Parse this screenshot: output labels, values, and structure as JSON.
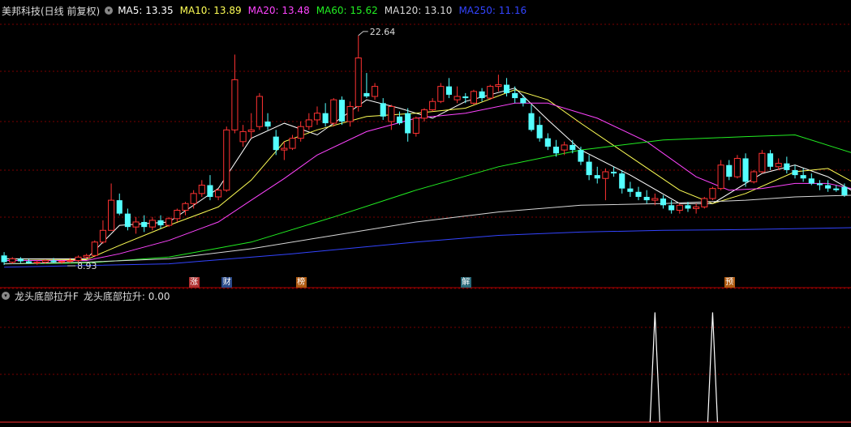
{
  "header": {
    "stock_title": "美邦科技(日线 前复权)",
    "ma": [
      {
        "label": "MA5: 13.35",
        "color": "#ffffff"
      },
      {
        "label": "MA10: 13.89",
        "color": "#ffff55"
      },
      {
        "label": "MA20: 13.48",
        "color": "#ff44ff"
      },
      {
        "label": "MA60: 15.62",
        "color": "#22ee22"
      },
      {
        "label": "MA120: 13.10",
        "color": "#d8d8d8"
      },
      {
        "label": "MA250: 11.16",
        "color": "#3344ff"
      }
    ]
  },
  "price_annotations": {
    "high_label": "22.64",
    "low_label": "8.93"
  },
  "events": [
    {
      "label": "涨",
      "bg": "#b03030"
    },
    {
      "label": "财",
      "bg": "#2a4a8a"
    },
    {
      "label": "榜",
      "bg": "#b05a10"
    },
    {
      "label": "解",
      "bg": "#2a6a7a"
    },
    {
      "label": "预",
      "bg": "#b05a10"
    }
  ],
  "indicator": {
    "name": "龙头底部拉升F",
    "value_label": "龙头底部拉升: 0.00"
  },
  "colors": {
    "up": "#ff3232",
    "down": "#54ffff",
    "grid": "#7a0000",
    "spike": "#ffffff"
  },
  "chart_data": {
    "type": "candlestick",
    "ohlc": [
      [
        9.5,
        9.7,
        8.93,
        9.1
      ],
      [
        9.1,
        9.4,
        9.0,
        9.3
      ],
      [
        9.3,
        9.4,
        9.05,
        9.15
      ],
      [
        9.15,
        9.3,
        9.0,
        9.05
      ],
      [
        9.05,
        9.2,
        8.95,
        9.1
      ],
      [
        9.1,
        9.25,
        9.0,
        9.2
      ],
      [
        9.2,
        9.35,
        9.05,
        9.1
      ],
      [
        9.1,
        9.2,
        9.0,
        9.15
      ],
      [
        9.15,
        9.35,
        9.05,
        9.2
      ],
      [
        9.2,
        9.5,
        9.1,
        9.4
      ],
      [
        9.4,
        9.6,
        9.3,
        9.5
      ],
      [
        9.5,
        10.4,
        9.4,
        10.3
      ],
      [
        10.3,
        11.6,
        10.2,
        11.0
      ],
      [
        11.0,
        13.8,
        11.0,
        12.8
      ],
      [
        12.8,
        13.2,
        11.9,
        12.0
      ],
      [
        12.0,
        12.3,
        11.0,
        11.2
      ],
      [
        11.2,
        11.8,
        10.8,
        11.5
      ],
      [
        11.5,
        11.9,
        10.9,
        11.2
      ],
      [
        11.2,
        11.8,
        11.0,
        11.6
      ],
      [
        11.6,
        11.9,
        11.1,
        11.3
      ],
      [
        11.3,
        11.8,
        11.2,
        11.7
      ],
      [
        11.7,
        12.3,
        11.5,
        12.2
      ],
      [
        12.2,
        12.7,
        11.9,
        12.6
      ],
      [
        12.6,
        13.4,
        12.3,
        13.2
      ],
      [
        13.2,
        14.0,
        13.0,
        13.7
      ],
      [
        13.7,
        14.3,
        12.8,
        13.0
      ],
      [
        13.0,
        13.5,
        12.8,
        13.4
      ],
      [
        13.4,
        17.2,
        13.3,
        17.0
      ],
      [
        17.0,
        21.5,
        16.8,
        20.0
      ],
      [
        16.3,
        17.3,
        16.0,
        16.9
      ],
      [
        16.9,
        18.0,
        16.5,
        17.0
      ],
      [
        17.2,
        19.2,
        17.0,
        19.0
      ],
      [
        17.5,
        18.0,
        17.0,
        17.2
      ],
      [
        16.6,
        17.0,
        15.5,
        15.8
      ],
      [
        15.8,
        16.3,
        15.2,
        15.9
      ],
      [
        15.9,
        16.7,
        15.8,
        16.5
      ],
      [
        16.5,
        17.5,
        16.3,
        17.2
      ],
      [
        17.2,
        18.0,
        17.0,
        17.6
      ],
      [
        17.6,
        18.4,
        17.3,
        18.0
      ],
      [
        18.0,
        18.6,
        17.2,
        17.4
      ],
      [
        17.4,
        18.9,
        17.2,
        18.8
      ],
      [
        18.8,
        19.0,
        17.3,
        17.5
      ],
      [
        17.5,
        18.7,
        17.2,
        18.4
      ],
      [
        18.4,
        22.64,
        18.1,
        21.3
      ],
      [
        19.2,
        20.4,
        18.9,
        19.0
      ],
      [
        19.0,
        19.8,
        18.8,
        19.6
      ],
      [
        18.6,
        18.9,
        17.6,
        17.8
      ],
      [
        17.5,
        18.5,
        17.0,
        18.4
      ],
      [
        17.8,
        18.1,
        17.3,
        17.4
      ],
      [
        18.0,
        18.3,
        16.3,
        16.8
      ],
      [
        16.8,
        17.8,
        16.6,
        17.7
      ],
      [
        17.7,
        18.3,
        17.5,
        18.2
      ],
      [
        18.2,
        18.9,
        18.1,
        18.7
      ],
      [
        18.7,
        19.8,
        18.6,
        19.6
      ],
      [
        19.6,
        20.1,
        18.9,
        19.1
      ],
      [
        18.8,
        19.6,
        18.6,
        19.0
      ],
      [
        19.0,
        19.2,
        18.6,
        18.9
      ],
      [
        18.6,
        19.4,
        18.5,
        19.3
      ],
      [
        19.3,
        19.5,
        18.7,
        18.9
      ],
      [
        18.9,
        19.7,
        18.8,
        19.6
      ],
      [
        19.6,
        20.3,
        19.3,
        19.7
      ],
      [
        19.7,
        20.1,
        19.0,
        19.2
      ],
      [
        19.2,
        19.6,
        18.6,
        18.9
      ],
      [
        18.9,
        19.1,
        18.4,
        18.6
      ],
      [
        18.0,
        18.5,
        16.9,
        17.0
      ],
      [
        17.3,
        17.8,
        16.3,
        16.5
      ],
      [
        16.5,
        16.8,
        15.8,
        16.0
      ],
      [
        16.0,
        16.4,
        15.4,
        15.6
      ],
      [
        15.8,
        16.3,
        15.5,
        16.1
      ],
      [
        16.1,
        16.4,
        15.6,
        15.8
      ],
      [
        15.8,
        16.0,
        14.9,
        15.1
      ],
      [
        15.1,
        15.5,
        14.0,
        14.3
      ],
      [
        14.3,
        14.8,
        13.8,
        14.1
      ],
      [
        14.1,
        14.7,
        12.8,
        14.5
      ],
      [
        14.5,
        14.8,
        14.2,
        14.4
      ],
      [
        14.4,
        14.6,
        13.2,
        13.5
      ],
      [
        13.5,
        13.9,
        13.0,
        13.3
      ],
      [
        13.3,
        13.6,
        12.8,
        13.0
      ],
      [
        13.0,
        13.4,
        12.6,
        12.8
      ],
      [
        12.8,
        13.2,
        12.5,
        12.9
      ],
      [
        12.9,
        13.1,
        12.3,
        12.5
      ],
      [
        12.5,
        12.8,
        12.0,
        12.2
      ],
      [
        12.2,
        12.6,
        12.0,
        12.5
      ],
      [
        12.5,
        12.7,
        12.1,
        12.3
      ],
      [
        12.3,
        12.6,
        12.0,
        12.4
      ],
      [
        12.4,
        13.0,
        12.3,
        12.9
      ],
      [
        12.9,
        13.6,
        12.8,
        13.5
      ],
      [
        13.5,
        15.2,
        13.4,
        14.9
      ],
      [
        14.9,
        15.2,
        14.0,
        14.2
      ],
      [
        14.2,
        15.5,
        14.1,
        15.3
      ],
      [
        15.3,
        15.6,
        13.6,
        13.9
      ],
      [
        13.9,
        14.6,
        13.8,
        14.5
      ],
      [
        14.5,
        15.8,
        14.4,
        15.6
      ],
      [
        15.6,
        15.8,
        14.6,
        14.8
      ],
      [
        14.8,
        15.3,
        14.6,
        15.0
      ],
      [
        15.0,
        15.4,
        14.4,
        14.6
      ],
      [
        14.6,
        14.9,
        14.1,
        14.3
      ],
      [
        14.3,
        14.7,
        13.9,
        14.1
      ],
      [
        14.1,
        14.4,
        13.7,
        13.8
      ],
      [
        13.8,
        14.0,
        13.4,
        13.7
      ],
      [
        13.7,
        14.0,
        13.3,
        13.5
      ],
      [
        13.5,
        13.7,
        13.3,
        13.4
      ],
      [
        13.6,
        13.8,
        13.0,
        13.1
      ]
    ],
    "ma": {
      "MA5": [
        [
          0,
          9.3
        ],
        [
          10,
          9.3
        ],
        [
          14,
          11.3
        ],
        [
          20,
          11.5
        ],
        [
          26,
          13.5
        ],
        [
          30,
          16.5
        ],
        [
          34,
          17.4
        ],
        [
          38,
          16.7
        ],
        [
          44,
          18.8
        ],
        [
          48,
          18.3
        ],
        [
          52,
          17.7
        ],
        [
          56,
          18.7
        ],
        [
          62,
          19.5
        ],
        [
          66,
          17.6
        ],
        [
          70,
          15.8
        ],
        [
          76,
          14.3
        ],
        [
          82,
          12.6
        ],
        [
          86,
          12.6
        ],
        [
          92,
          14.4
        ],
        [
          96,
          14.9
        ],
        [
          100,
          14.2
        ],
        [
          103,
          13.35
        ]
      ],
      "MA10": [
        [
          0,
          9.2
        ],
        [
          10,
          9.25
        ],
        [
          14,
          10.1
        ],
        [
          20,
          11.3
        ],
        [
          26,
          12.4
        ],
        [
          30,
          14.0
        ],
        [
          34,
          16.3
        ],
        [
          38,
          17.0
        ],
        [
          44,
          17.8
        ],
        [
          50,
          18.0
        ],
        [
          56,
          18.3
        ],
        [
          62,
          19.4
        ],
        [
          66,
          18.8
        ],
        [
          70,
          17.4
        ],
        [
          76,
          15.4
        ],
        [
          82,
          13.4
        ],
        [
          86,
          12.6
        ],
        [
          90,
          13.2
        ],
        [
          96,
          14.5
        ],
        [
          100,
          14.7
        ],
        [
          103,
          13.89
        ]
      ],
      "MA20": [
        [
          0,
          9.2
        ],
        [
          10,
          9.2
        ],
        [
          14,
          9.6
        ],
        [
          20,
          10.4
        ],
        [
          26,
          11.5
        ],
        [
          30,
          12.8
        ],
        [
          34,
          14.1
        ],
        [
          38,
          15.5
        ],
        [
          44,
          16.9
        ],
        [
          50,
          17.7
        ],
        [
          56,
          18.0
        ],
        [
          62,
          18.6
        ],
        [
          66,
          18.6
        ],
        [
          72,
          17.7
        ],
        [
          78,
          16.3
        ],
        [
          84,
          14.2
        ],
        [
          88,
          13.4
        ],
        [
          92,
          13.5
        ],
        [
          96,
          13.8
        ],
        [
          100,
          13.8
        ],
        [
          103,
          13.48
        ]
      ],
      "MA60": [
        [
          0,
          9.0
        ],
        [
          10,
          9.05
        ],
        [
          20,
          9.4
        ],
        [
          30,
          10.3
        ],
        [
          40,
          11.8
        ],
        [
          50,
          13.4
        ],
        [
          60,
          14.8
        ],
        [
          70,
          15.8
        ],
        [
          80,
          16.4
        ],
        [
          90,
          16.6
        ],
        [
          96,
          16.7
        ],
        [
          103,
          15.62
        ]
      ],
      "MA120": [
        [
          0,
          9.0
        ],
        [
          10,
          9.1
        ],
        [
          20,
          9.3
        ],
        [
          30,
          9.9
        ],
        [
          40,
          10.7
        ],
        [
          50,
          11.5
        ],
        [
          60,
          12.1
        ],
        [
          70,
          12.5
        ],
        [
          80,
          12.6
        ],
        [
          90,
          12.8
        ],
        [
          96,
          13.0
        ],
        [
          103,
          13.1
        ]
      ],
      "MA250": [
        [
          0,
          8.8
        ],
        [
          20,
          9.0
        ],
        [
          35,
          9.6
        ],
        [
          50,
          10.3
        ],
        [
          60,
          10.7
        ],
        [
          70,
          10.9
        ],
        [
          80,
          11.0
        ],
        [
          90,
          11.05
        ],
        [
          103,
          11.16
        ]
      ]
    },
    "ylim": [
      8.4,
      23.6
    ],
    "high": {
      "index": 43,
      "value": 22.64
    },
    "low": {
      "index": 0,
      "value": 8.93
    },
    "event_indices": [
      23,
      27,
      36,
      56,
      88,
      102
    ],
    "indicator_values": [
      0,
      0,
      0,
      0,
      0,
      0,
      0,
      0,
      0,
      0,
      0,
      0,
      0,
      0,
      0,
      0,
      0,
      0,
      0,
      0,
      0,
      0,
      0,
      0,
      0,
      0,
      0,
      0,
      0,
      0,
      0,
      0,
      0,
      0,
      0,
      0,
      0,
      0,
      0,
      0,
      0,
      0,
      0,
      0,
      0,
      0,
      0,
      0,
      0,
      0,
      0,
      0,
      0,
      0,
      0,
      0,
      0,
      0,
      0,
      0,
      0,
      0,
      0,
      0,
      0,
      0,
      0,
      0,
      0,
      0,
      0,
      0,
      0,
      0,
      0,
      0,
      0,
      0,
      0,
      1,
      0,
      0,
      0,
      0,
      0,
      0,
      1,
      0,
      0,
      0,
      0,
      0,
      0,
      0,
      0,
      0,
      0,
      0,
      0,
      0,
      0,
      0,
      0,
      0
    ],
    "indicator_ylim": [
      0,
      1.1
    ]
  }
}
